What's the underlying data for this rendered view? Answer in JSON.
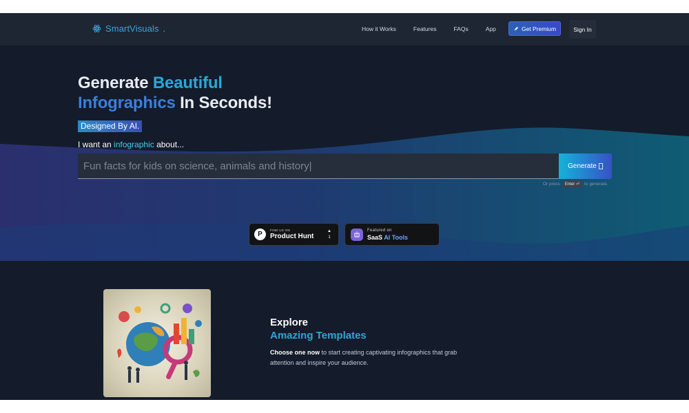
{
  "nav": {
    "brand": "SmartVisuals",
    "brand_dot": ".",
    "links": [
      "How it Works",
      "Features",
      "FAQs",
      "App"
    ],
    "premium_label": "Get Premium",
    "signin_label": "Sign In"
  },
  "hero": {
    "headline_part1": "Generate ",
    "headline_accent1": "Beautiful",
    "headline_accent2": "Infographics",
    "headline_part2": " In Seconds!",
    "ai_badge": "Designed By AI.",
    "prompt_prefix": "I want an ",
    "prompt_highlight": "infographic",
    "prompt_suffix": " about...",
    "search_placeholder": "Fun facts for kids on science, animals and history|",
    "generate_label": "Generate",
    "hint_prefix": "Or press",
    "hint_key": "Enter",
    "hint_suffix": "to generate."
  },
  "badges": {
    "producthunt_small": "FIND US ON",
    "producthunt_big": "Product Hunt",
    "producthunt_votes": "1",
    "saas_small": "Featured on",
    "saas_big_1": "SaaS ",
    "saas_big_2": "AI Tools"
  },
  "explore": {
    "title": "Explore",
    "subtitle": "Amazing Templates",
    "desc_bold": "Choose one now",
    "desc_rest": " to start creating captivating infographics that grab attention and inspire your audience."
  },
  "colors": {
    "background": "#141b2a",
    "nav": "#1e2634",
    "accent": "#27a9d8",
    "accent2": "#3b7fd9",
    "wave": "#2a3f7a"
  }
}
